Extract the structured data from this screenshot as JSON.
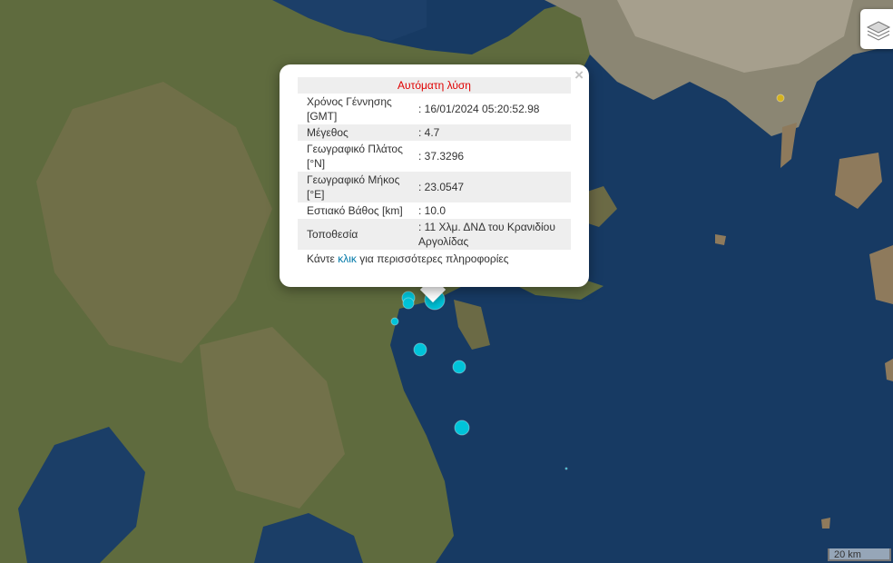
{
  "map": {
    "markers": [
      {
        "color": "#00c3d9",
        "size": "large"
      },
      {
        "color": "#00c3d9",
        "size": "medium"
      },
      {
        "color": "#00c3d9",
        "size": "medium"
      },
      {
        "color": "#00c3d9",
        "size": "medium"
      },
      {
        "color": "#00c3d9",
        "size": "small"
      },
      {
        "color": "#00c3d9",
        "size": "medium"
      },
      {
        "color": "#00c3d9",
        "size": "medium"
      },
      {
        "color": "#d4b21f",
        "size": "medium"
      },
      {
        "color": "#00c3d9",
        "size": "small"
      }
    ],
    "scale_label": "20 km",
    "layers_icon": "layers-icon"
  },
  "popup": {
    "close_label": "×",
    "title": "Αυτόματη λύση",
    "rows": [
      {
        "label": "Χρόνος Γέννησης [GMT]",
        "value": ": 16/01/2024 05:20:52.98"
      },
      {
        "label": "Μέγεθος",
        "value": ": 4.7"
      },
      {
        "label": "Γεωγραφικό Πλάτος [°N]",
        "value": ": 37.3296"
      },
      {
        "label": "Γεωγραφικό Μήκος [°E]",
        "value": ": 23.0547"
      },
      {
        "label": "Εστιακό Βάθος [km]",
        "value": ": 10.0"
      },
      {
        "label": "Τοποθεσία",
        "value": ": 11 Χλμ. ΔΝΔ του Κρανιδίου Αργολίδας"
      }
    ],
    "footer_prefix": "Κάντε",
    "footer_link": "κλικ",
    "footer_suffix": "για περισσότερες πληροφορίες"
  },
  "colors": {
    "title_red": "#e00000",
    "link_blue": "#0078a8",
    "marker_cyan": "#00c3d9",
    "marker_yellow": "#d4b21f"
  }
}
